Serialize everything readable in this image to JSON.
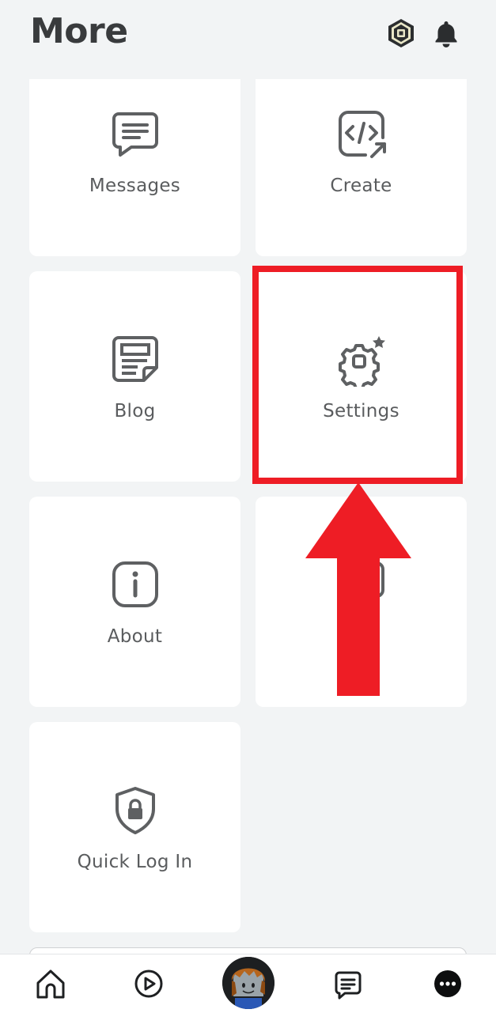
{
  "header": {
    "title": "More",
    "icons": [
      "robux-icon",
      "notification-bell-icon"
    ]
  },
  "tiles": [
    {
      "label": "Messages",
      "icon": "message-icon"
    },
    {
      "label": "Create",
      "icon": "code-create-icon"
    },
    {
      "label": "Blog",
      "icon": "blog-icon"
    },
    {
      "label": "Settings",
      "icon": "gear-icon"
    },
    {
      "label": "About",
      "icon": "info-icon"
    },
    {
      "label": "",
      "icon": "help-icon"
    },
    {
      "label": "Quick Log In",
      "icon": "shield-lock-icon"
    }
  ],
  "annotation": {
    "highlight_color": "#ee1d25",
    "highlighted_tile": "Settings"
  },
  "tabbar": {
    "items": [
      "home-icon",
      "play-icon",
      "avatar",
      "chat-icon",
      "more-icon"
    ],
    "active": "more-icon"
  },
  "colors": {
    "background": "#f2f4f5",
    "tile": "#ffffff",
    "text": "#5a5c5e",
    "title": "#393b3d"
  }
}
